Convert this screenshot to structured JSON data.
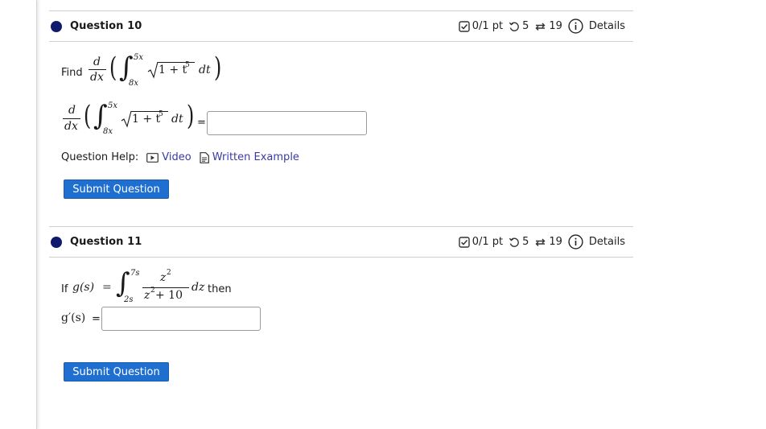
{
  "questions": [
    {
      "title": "Question 10",
      "score": "0/1 pt",
      "retries": "5",
      "attempts": "19",
      "details_label": "Details",
      "find_label": "Find",
      "equals": "=",
      "math": {
        "d": "d",
        "dx": "dx",
        "upper": "5x",
        "lower": "8x",
        "integrand": "1 + t",
        "exp": "5",
        "dt": "dt"
      },
      "answer_value": "",
      "help_label": "Question Help:",
      "video_label": "Video",
      "written_example_label": "Written Example",
      "submit_label": "Submit Question"
    },
    {
      "title": "Question 11",
      "score": "0/1 pt",
      "retries": "5",
      "attempts": "19",
      "details_label": "Details",
      "if_label": "If",
      "then_label": "then",
      "equals": "=",
      "math": {
        "g_s": "g(s)",
        "upper": "7s",
        "lower": "2s",
        "num": "z",
        "num_exp": "2",
        "den": "z",
        "den_exp": "2",
        "den_tail": " + 10",
        "dz": "dz",
        "gprime": "g′(s)"
      },
      "answer_value": "",
      "submit_label": "Submit Question"
    }
  ],
  "colors": {
    "accent": "#1f6fd1",
    "dot": "#0f1a6e",
    "link": "#3a3aa6"
  },
  "icons": [
    "checkbox-icon",
    "retry-icon",
    "attempts-icon",
    "info-icon",
    "video-icon",
    "document-icon"
  ]
}
